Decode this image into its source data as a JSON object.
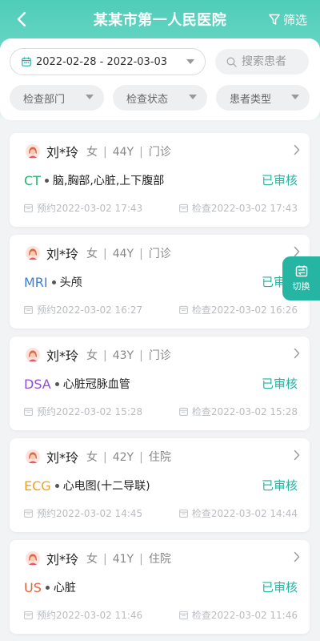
{
  "header": {
    "title": "某某市第一人民医院",
    "filter_label": "筛选"
  },
  "filters": {
    "date_range": "2022-02-28 - 2022-03-03",
    "search_placeholder": "搜索患者",
    "search_value": "",
    "department": "检查部门",
    "exam_status": "检查状态",
    "patient_type": "患者类型"
  },
  "switch_label": "切换",
  "records": [
    {
      "name": "刘*玲",
      "gender": "女",
      "age": "44Y",
      "visit": "门诊",
      "modality": "CT",
      "modality_color": "#22b573",
      "body_part": "脑,胸部,心脏,上下腹部",
      "status": "已审核",
      "appointment": "预约2022-03-02 17:43",
      "exam": "检查2022-03-02 17:43"
    },
    {
      "name": "刘*玲",
      "gender": "女",
      "age": "44Y",
      "visit": "门诊",
      "modality": "MRI",
      "modality_color": "#3d7ddc",
      "body_part": "头颅",
      "status": "已审核",
      "appointment": "预约2022-03-02 16:27",
      "exam": "检查2022-03-02 16:26"
    },
    {
      "name": "刘*玲",
      "gender": "女",
      "age": "43Y",
      "visit": "门诊",
      "modality": "DSA",
      "modality_color": "#8f4fd0",
      "body_part": "心脏冠脉血管",
      "status": "已审核",
      "appointment": "预约2022-03-02 15:28",
      "exam": "检查2022-03-02 15:28"
    },
    {
      "name": "刘*玲",
      "gender": "女",
      "age": "42Y",
      "visit": "住院",
      "modality": "ECG",
      "modality_color": "#f0a020",
      "body_part": "心电图(十二导联)",
      "status": "已审核",
      "appointment": "预约2022-03-02 14:45",
      "exam": "检查2022-03-02 14:44"
    },
    {
      "name": "刘*玲",
      "gender": "女",
      "age": "41Y",
      "visit": "住院",
      "modality": "US",
      "modality_color": "#e8603c",
      "body_part": "心脏",
      "status": "已审核",
      "appointment": "预约2022-03-02 11:46",
      "exam": "检查2022-03-02 11:46"
    }
  ]
}
